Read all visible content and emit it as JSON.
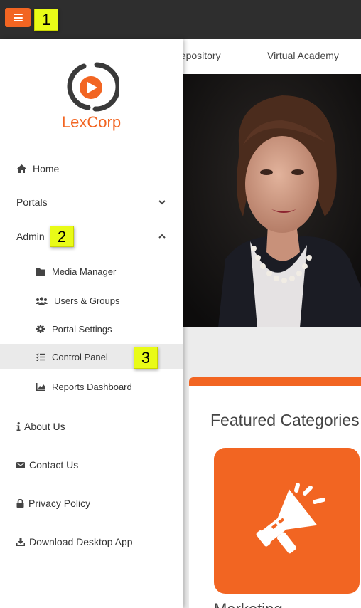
{
  "topbar": {
    "menu_icon": "hamburger-icon",
    "accent_color": "#f26522",
    "background_color": "#2e2e2e"
  },
  "markers": [
    "1",
    "2",
    "3"
  ],
  "nav": {
    "links": [
      "a Repository",
      "Virtual Academy"
    ]
  },
  "sidebar": {
    "brand": "LexCorp",
    "logo_icon": "play-logo-icon",
    "items": [
      {
        "label": "Home",
        "icon": "home-icon"
      },
      {
        "label": "Portals",
        "icon": "chevron-down-icon"
      },
      {
        "label": "Admin",
        "icon": "chevron-up-icon"
      },
      {
        "label": "Media Manager",
        "icon": "folder-icon"
      },
      {
        "label": "Users & Groups",
        "icon": "users-icon"
      },
      {
        "label": "Portal Settings",
        "icon": "gear-icon"
      },
      {
        "label": "Control Panel",
        "icon": "tasks-icon"
      },
      {
        "label": "Reports Dashboard",
        "icon": "area-chart-icon"
      },
      {
        "label": "About Us",
        "icon": "info-icon"
      },
      {
        "label": "Contact Us",
        "icon": "envelope-icon"
      },
      {
        "label": "Privacy Policy",
        "icon": "lock-icon"
      },
      {
        "label": "Download Desktop App",
        "icon": "download-icon"
      }
    ]
  },
  "main": {
    "featured_title": "Featured Categories",
    "categories": [
      {
        "label": "Marketing",
        "icon": "megaphone-icon"
      }
    ]
  }
}
